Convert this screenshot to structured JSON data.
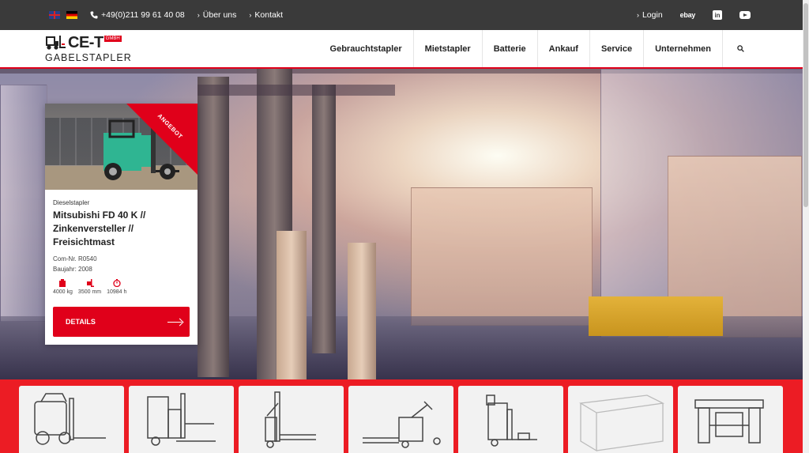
{
  "topbar": {
    "languages": [
      "English",
      "Deutsch"
    ],
    "phone": "+49(0)211 99 61 40 08",
    "links": [
      "Über uns",
      "Kontakt"
    ],
    "login": "Login",
    "ebay": "ebay",
    "linkedin": "in"
  },
  "logo": {
    "name": "CE-T",
    "gmbh": "GMBH",
    "sub": "GABELSTAPLER"
  },
  "nav": {
    "items": [
      "Gebrauchtstapler",
      "Mietstapler",
      "Batterie",
      "Ankauf",
      "Service",
      "Unternehmen"
    ]
  },
  "offer_card": {
    "ribbon": "ANGEBOT",
    "category": "Dieselstapler",
    "title": "Mitsubishi FD 40 K // Zinkenversteller // Freisichtmast",
    "com_nr": "Com-Nr. R0540",
    "year": "Baujahr: 2008",
    "specs": [
      {
        "icon": "weight-icon",
        "value": "4000 kg"
      },
      {
        "icon": "lift-height-icon",
        "value": "3500 mm"
      },
      {
        "icon": "hours-icon",
        "value": "10984 h"
      }
    ],
    "button": "DETAILS"
  },
  "categories": [
    {
      "icon": "counterbalance-forklift-icon"
    },
    {
      "icon": "reach-truck-icon"
    },
    {
      "icon": "pallet-stacker-icon"
    },
    {
      "icon": "electric-pallet-truck-icon"
    },
    {
      "icon": "order-picker-icon"
    },
    {
      "icon": "battery-icon"
    },
    {
      "icon": "attachment-icon"
    }
  ],
  "colors": {
    "brand_red": "#e0001a",
    "topbar": "#3a3a3a",
    "strip_red": "#ec1c24"
  }
}
